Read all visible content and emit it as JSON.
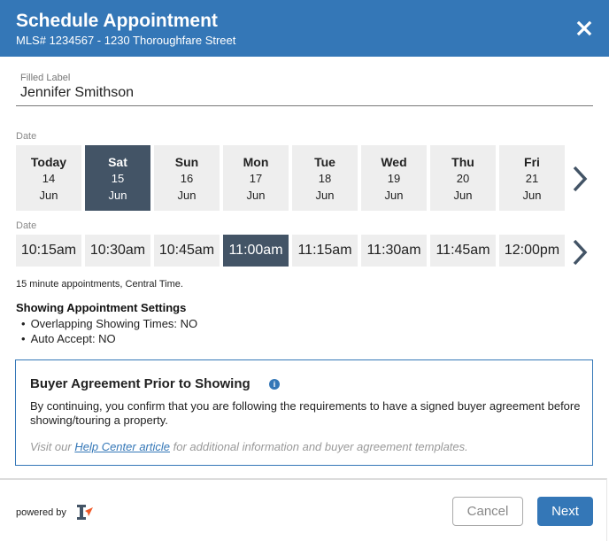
{
  "header": {
    "title": "Schedule Appointment",
    "subtitle": "MLS# 1234567 - 1230 Thoroughfare Street",
    "close_icon": "close-icon"
  },
  "name_field": {
    "label": "Filled Label",
    "value": "Jennifer Smithson"
  },
  "date_section": {
    "label": "Date",
    "selected_index": 1,
    "dates": [
      {
        "dow": "Today",
        "day": "14",
        "month": "Jun"
      },
      {
        "dow": "Sat",
        "day": "15",
        "month": "Jun"
      },
      {
        "dow": "Sun",
        "day": "16",
        "month": "Jun"
      },
      {
        "dow": "Mon",
        "day": "17",
        "month": "Jun"
      },
      {
        "dow": "Tue",
        "day": "18",
        "month": "Jun"
      },
      {
        "dow": "Wed",
        "day": "19",
        "month": "Jun"
      },
      {
        "dow": "Thu",
        "day": "20",
        "month": "Jun"
      },
      {
        "dow": "Fri",
        "day": "21",
        "month": "Jun"
      }
    ],
    "next_icon": "chevron-right-icon"
  },
  "time_section": {
    "label": "Date",
    "selected_index": 3,
    "times": [
      "10:15am",
      "10:30am",
      "10:45am",
      "11:00am",
      "11:15am",
      "11:30am",
      "11:45am",
      "12:00pm"
    ],
    "next_icon": "chevron-right-icon"
  },
  "note": "15 minute appointments, Central Time.",
  "settings": {
    "title": "Showing Appointment Settings",
    "items": [
      "Overlapping Showing Times: NO",
      "Auto Accept: NO"
    ]
  },
  "agreement": {
    "title": "Buyer Agreement Prior to Showing",
    "info_icon": "info-icon",
    "body": "By continuing, you confirm that you are following the requirements to have a signed buyer agreement before showing/touring a property.",
    "help_prefix": "Visit our ",
    "help_link": "Help Center article",
    "help_suffix": " for additional information and buyer agreement templates."
  },
  "footer": {
    "powered_by": "powered by",
    "cancel_label": "Cancel",
    "next_label": "Next"
  },
  "colors": {
    "brand": "#3477b7",
    "selected": "#435466",
    "cell_bg": "#eeeeee",
    "logo_accent": "#f05a28"
  }
}
